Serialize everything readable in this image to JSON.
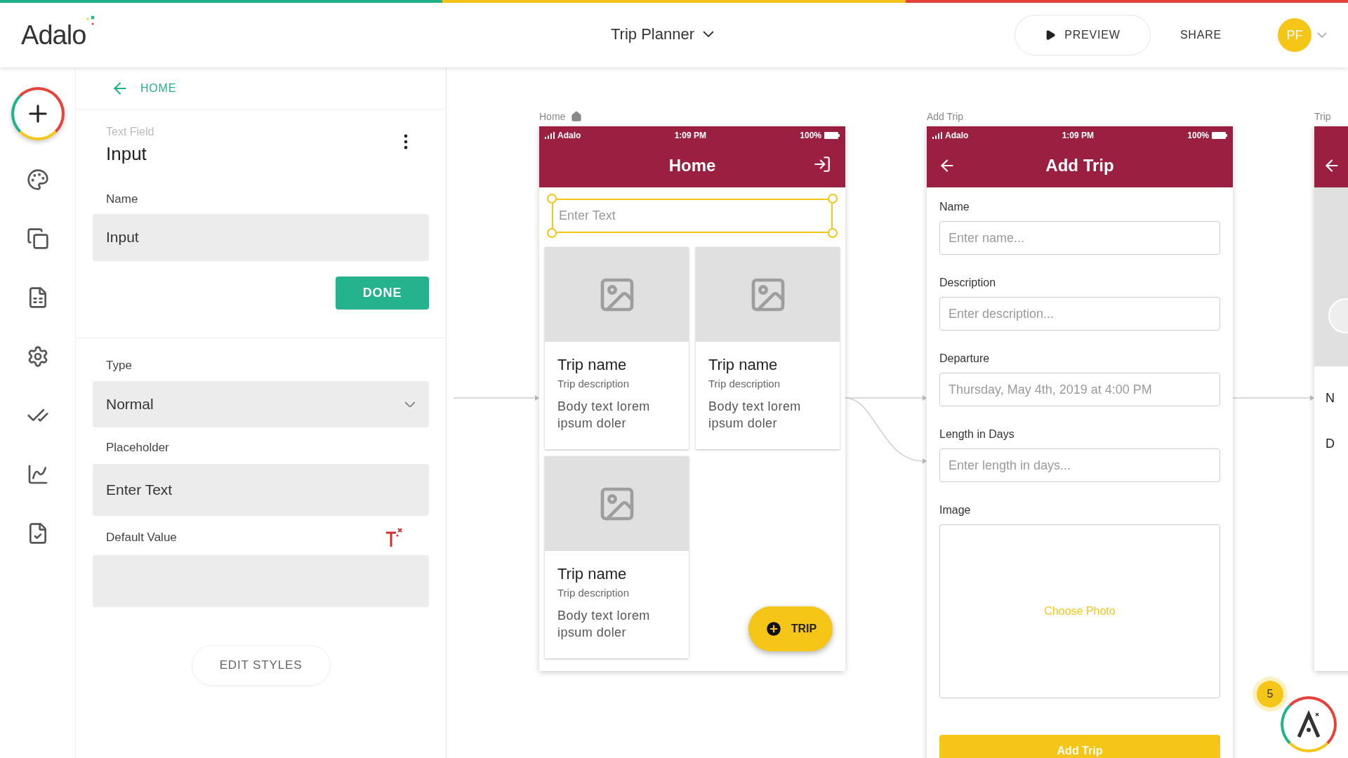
{
  "topbar": {
    "logo": "Adalo",
    "app_name": "Trip Planner",
    "preview": "PREVIEW",
    "share": "SHARE",
    "avatar": "PF"
  },
  "panel": {
    "back": "HOME",
    "component_type": "Text Field",
    "component_name": "Input",
    "name_label": "Name",
    "name_value": "Input",
    "done": "DONE",
    "fields": [
      {
        "label": "Type",
        "kind": "select",
        "value": "Normal"
      },
      {
        "label": "Placeholder",
        "kind": "text",
        "value": "Enter Text"
      },
      {
        "label": "Default Value",
        "kind": "magic"
      }
    ],
    "edit_styles": "EDIT STYLES"
  },
  "screens": [
    {
      "label": "Home",
      "kind": "list",
      "carrier": "Adalo",
      "time": "1:09 PM",
      "battery": "100%",
      "title": "Home",
      "input_placeholder": "Enter Text",
      "input_selected": true,
      "cards": [
        {
          "title": "Trip name",
          "subtitle": "Trip description",
          "body": "Body text lorem ipsum doler"
        },
        {
          "title": "Trip name",
          "subtitle": "Trip description",
          "body": "Body text lorem ipsum doler"
        },
        {
          "title": "Trip name",
          "subtitle": "Trip description",
          "body": "Body text lorem ipsum doler"
        }
      ],
      "fab": "TRIP"
    },
    {
      "label": "Add Trip",
      "kind": "form",
      "carrier": "Adalo",
      "time": "1:09 PM",
      "battery": "100%",
      "title": "Add Trip",
      "fields": [
        {
          "label": "Name",
          "placeholder": "Enter name..."
        },
        {
          "label": "Description",
          "placeholder": "Enter description..."
        },
        {
          "label": "Departure",
          "placeholder": "Thursday, May 4th, 2019 at 4:00 PM"
        },
        {
          "label": "Length in Days",
          "placeholder": "Enter length in days..."
        }
      ],
      "image_label": "Image",
      "choose_photo": "Choose Photo",
      "submit": "Add Trip"
    },
    {
      "label": "Trip",
      "kind": "partial",
      "letters": [
        "N",
        "D"
      ]
    }
  ],
  "help": {
    "count": "5"
  }
}
